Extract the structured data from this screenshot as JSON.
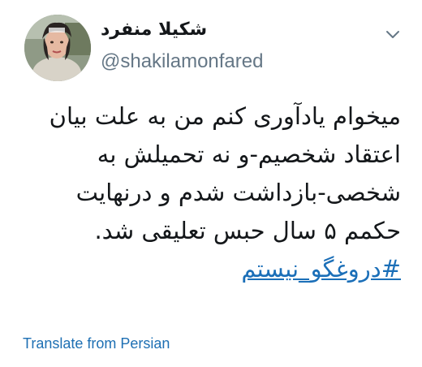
{
  "author": {
    "display_name": "شکیلا منفرد",
    "username": "@shakilamonfared",
    "avatar_icon": "profile-photo"
  },
  "menu": {
    "icon": "chevron-down-icon"
  },
  "tweet": {
    "lines": [
      "میخوام یادآوری کنم من به علت بیان",
      "اعتقاد شخصیم-و نه تحمیلش به",
      "شخصی-بازداشت شدم و درنهایت",
      "حکمم ۵ سال حبس تعلیقی شد."
    ],
    "hashtag": "#دروغگو_نیستم"
  },
  "translate": {
    "label": "Translate from Persian"
  },
  "colors": {
    "text": "#14171a",
    "muted": "#657786",
    "link": "#1b6fb8"
  }
}
